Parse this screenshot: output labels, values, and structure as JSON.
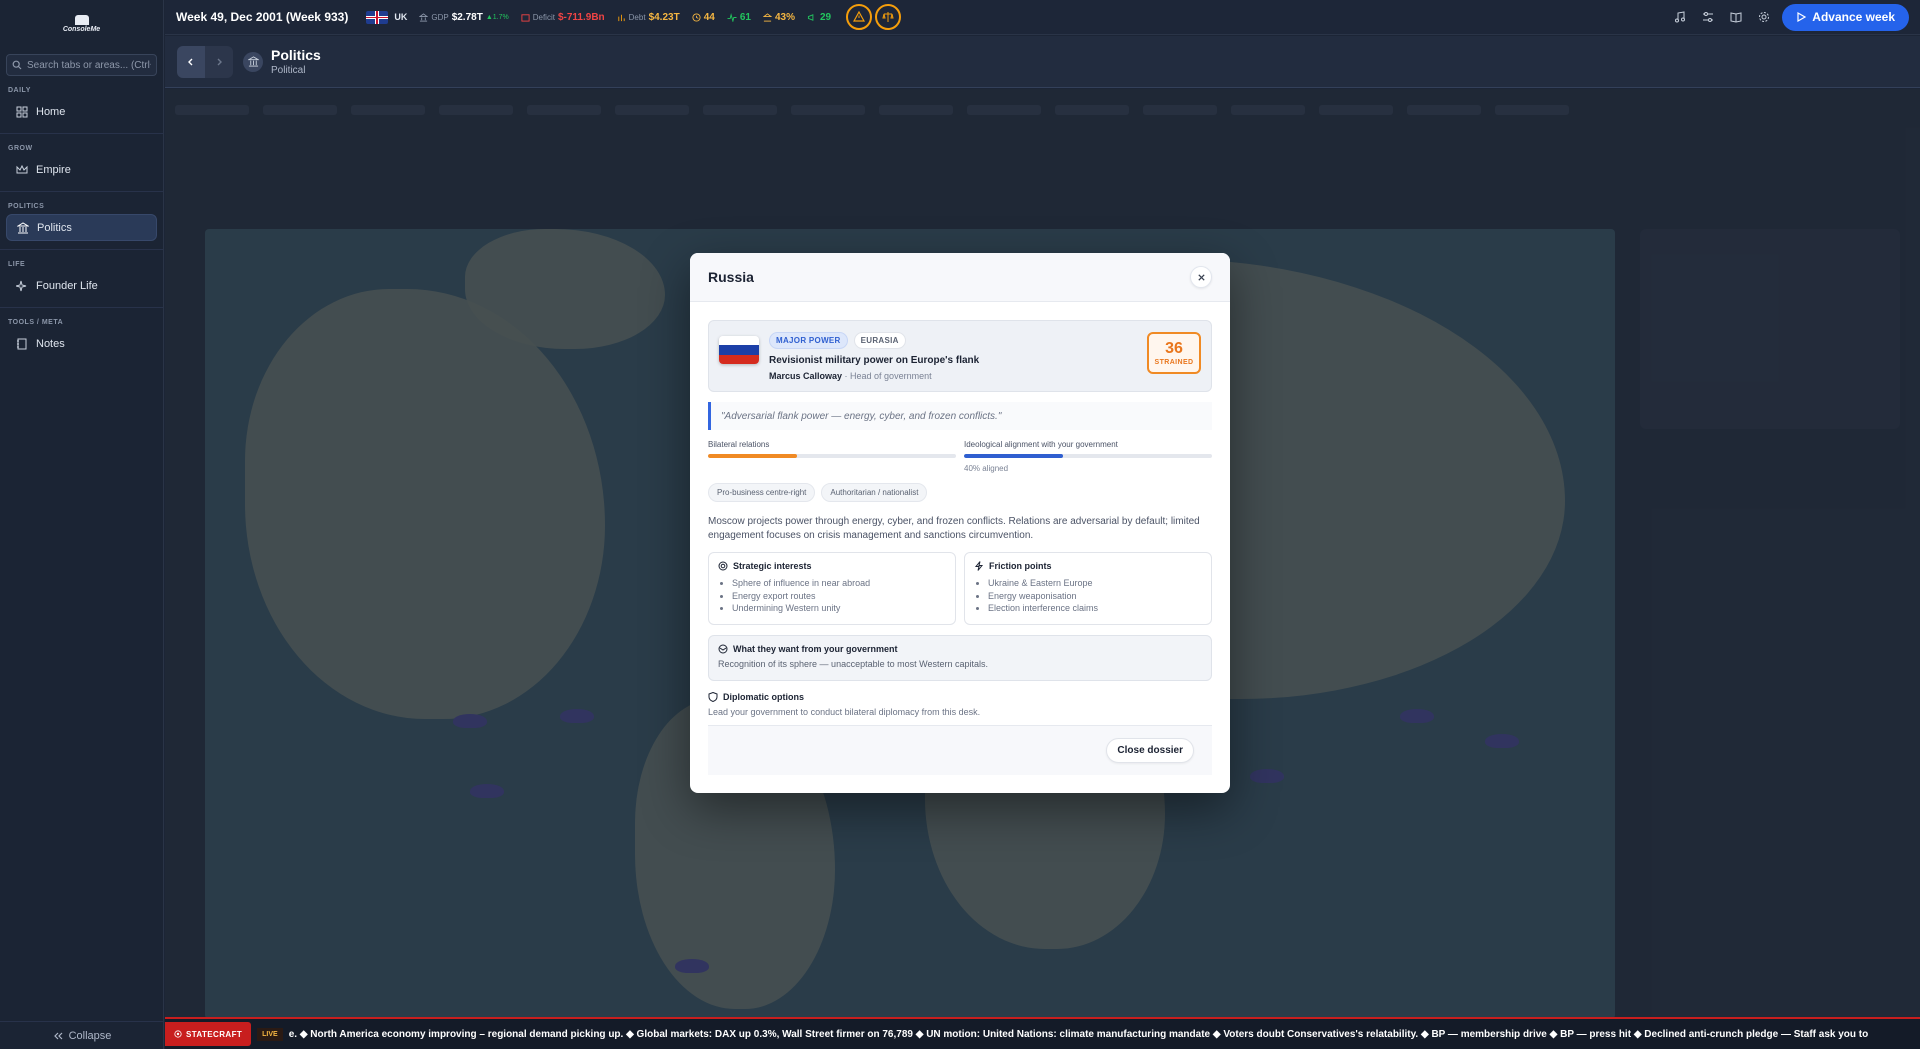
{
  "app": {
    "brand": "ConsoleMe"
  },
  "sidebar": {
    "search_placeholder": "Search tabs or areas... (Ctrl+K)",
    "sections": [
      {
        "label": "DAILY",
        "item": "Home"
      },
      {
        "label": "GROW",
        "item": "Empire"
      },
      {
        "label": "POLITICS",
        "item": "Politics"
      },
      {
        "label": "LIFE",
        "item": "Founder Life"
      },
      {
        "label": "TOOLS / META",
        "item": "Notes"
      }
    ],
    "active_item": "Politics",
    "collapse_label": "Collapse"
  },
  "topbar": {
    "week": "Week 49, Dec 2001 (Week 933)",
    "country": "UK",
    "gdp_label": "GDP",
    "gdp_value": "$2.78T",
    "gdp_change": "▲1.7%",
    "deficit_label": "Deficit",
    "deficit_value": "$-711.9Bn",
    "debt_label": "Debt",
    "debt_value": "$4.23T",
    "stat_a": "44",
    "stat_b": "61",
    "stat_c": "43%",
    "stat_d": "29",
    "advance_label": "Advance week",
    "colors": {
      "accent": "#2563eb",
      "warning": "#f59e0b",
      "negative": "#ef4444",
      "positive": "#22c55e"
    }
  },
  "page": {
    "title": "Politics",
    "subtitle": "Political"
  },
  "modal": {
    "title": "Russia",
    "tags": [
      "MAJOR POWER",
      "EURASIA"
    ],
    "tagline": "Revisionist military power on Europe's flank",
    "leader_name": "Marcus Calloway",
    "leader_role": " · Head of government",
    "relation_score": "36",
    "relation_status": "STRAINED",
    "quote": "\"Adversarial flank power — energy, cyber, and frozen conflicts.\"",
    "bilateral_label": "Bilateral relations",
    "bilateral_value": 0.36,
    "alignment_label": "Ideological alignment with your government",
    "alignment_value": 0.4,
    "alignment_note": "40% aligned",
    "chips": [
      "Pro-business centre-right",
      "Authoritarian / nationalist"
    ],
    "description": "Moscow projects power through energy, cyber, and frozen conflicts. Relations are adversarial by default; limited engagement focuses on crisis management and sanctions circumvention.",
    "strategic_title": "Strategic interests",
    "strategic_items": [
      "Sphere of influence in near abroad",
      "Energy export routes",
      "Undermining Western unity"
    ],
    "friction_title": "Friction points",
    "friction_items": [
      "Ukraine & Eastern Europe",
      "Energy weaponisation",
      "Election interference claims"
    ],
    "wants_title": "What they want from your government",
    "wants_text": "Recognition of its sphere — unacceptable to most Western capitals.",
    "diplo_title": "Diplomatic options",
    "diplo_text": "Lead your government to conduct bilateral diplomacy from this desk.",
    "close_label": "Close dossier"
  },
  "ticker": {
    "brand": "STATECRAFT",
    "live": "LIVE",
    "text": "e. ◆ North America economy improving – regional demand picking up. ◆ Global markets: DAX up 0.3%, Wall Street firmer on 76,789 ◆ UN motion: United Nations: climate manufacturing mandate ◆ Voters doubt Conservatives's relatability. ◆ BP — membership drive ◆ BP — press hit ◆ Declined anti-crunch pledge — Staff ask you to sign a public pledge against w"
  }
}
